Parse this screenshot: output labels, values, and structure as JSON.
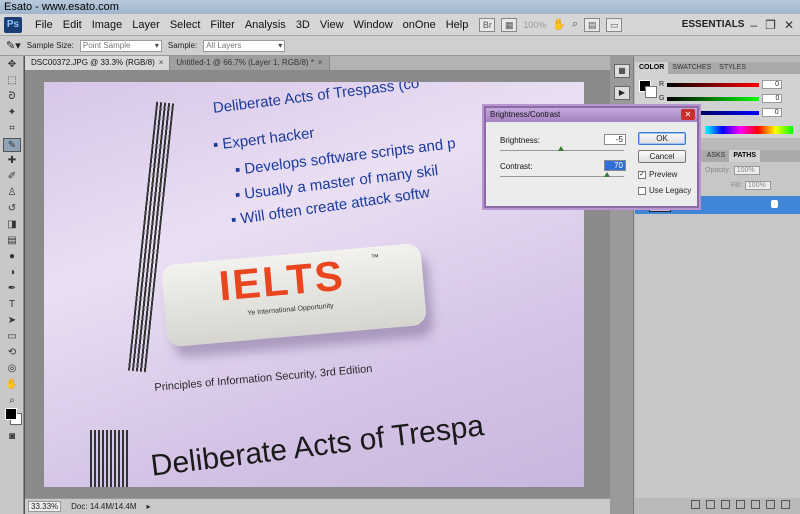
{
  "window": {
    "title": "Esato - www.esato.com"
  },
  "menubar": {
    "app_logo": "Ps",
    "items": [
      "File",
      "Edit",
      "Image",
      "Layer",
      "Select",
      "Filter",
      "Analysis",
      "3D",
      "View",
      "Window",
      "onOne",
      "Help"
    ],
    "zoom_select": "100%",
    "workspace": "ESSENTIALS"
  },
  "options_bar": {
    "sample_size_label": "Sample Size:",
    "sample_size_value": "Point Sample",
    "sample_label": "Sample:",
    "sample_value": "All Layers"
  },
  "doc_tabs": [
    {
      "label": "DSC00372.JPG @ 33.3% (RGB/8)",
      "close": "×"
    },
    {
      "label": "Untitled-1 @ 66.7% (Layer 1, RGB/8) *",
      "close": "×"
    }
  ],
  "photo": {
    "heading": "Deliberate Acts of Trespass (co",
    "bullets": [
      "Expert hacker",
      "Develops software scripts and p",
      "Usually a master of many skil",
      "Will often create attack softw"
    ],
    "eraser_logo": "IELTS",
    "eraser_tm": "™",
    "eraser_tagline": "Ye International Opportunity",
    "footer": "Principles of Information Security, 3rd Edition",
    "bottom_heading": "Deliberate Acts of Trespa"
  },
  "statusbar": {
    "zoom": "33.33%",
    "doc": "Doc: 14.4M/14.4M"
  },
  "color_panel": {
    "tabs": [
      "COLOR",
      "SWATCHES",
      "STYLES"
    ],
    "channels": [
      {
        "name": "R",
        "value": "0"
      },
      {
        "name": "G",
        "value": "0"
      },
      {
        "name": "B",
        "value": "0"
      }
    ]
  },
  "layers_panel": {
    "tabs": [
      "ASKS",
      "PATHS"
    ],
    "opacity_label": "Opacity:",
    "opacity_value": "100%",
    "fill_label": "Fill:",
    "fill_value": "100%",
    "layer_name": "und"
  },
  "dialog": {
    "title": "Brightness/Contrast",
    "brightness_label": "Brightness:",
    "brightness_value": "-5",
    "contrast_label": "Contrast:",
    "contrast_value": "70",
    "ok_label": "OK",
    "cancel_label": "Cancel",
    "preview_label": "Preview",
    "preview_checked": "✓",
    "legacy_label": "Use Legacy"
  }
}
